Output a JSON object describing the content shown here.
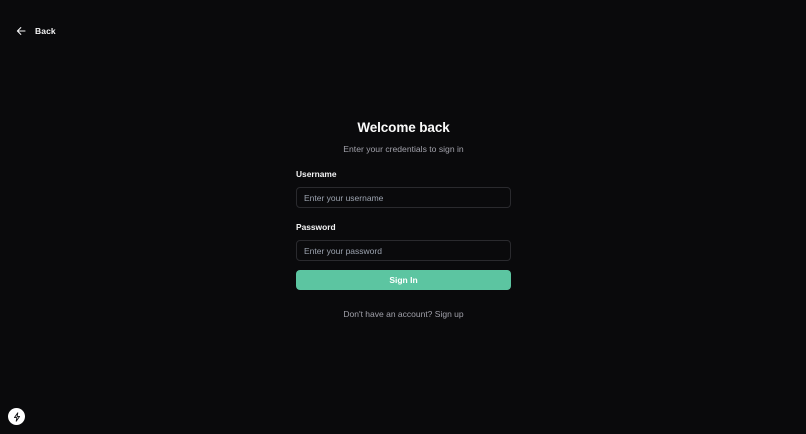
{
  "header": {
    "back_label": "Back",
    "back_icon": "arrow-left-icon"
  },
  "auth": {
    "title": "Welcome back",
    "subtitle": "Enter your credentials to sign in",
    "username": {
      "label": "Username",
      "placeholder": "Enter your username",
      "value": ""
    },
    "password": {
      "label": "Password",
      "placeholder": "Enter your password",
      "value": ""
    },
    "submit_label": "Sign In",
    "signup_prompt": "Don't have an account?",
    "signup_link": "Sign up"
  },
  "dev_badge": {
    "icon": "lightning-bolt-icon"
  },
  "colors": {
    "background": "#0a0a0c",
    "accent": "#5cc5a1",
    "input_border": "#2a2a2e",
    "muted_text": "#a1a1aa"
  }
}
